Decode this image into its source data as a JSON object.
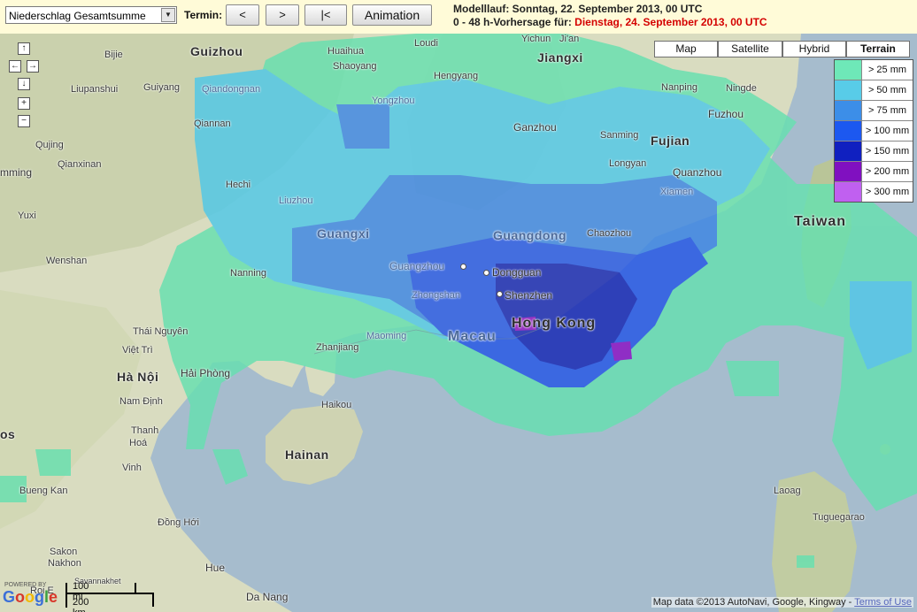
{
  "toolbar": {
    "product_select": "Niederschlag Gesamtsumme",
    "termin_label": "Termin:",
    "prev_label": "<",
    "next_label": ">",
    "first_label": "|<",
    "animation_label": "Animation",
    "model_run": "Modelllauf: Sonntag, 22. September 2013, 00 UTC",
    "forecast_prefix": "0 - 48 h-Vorhersage für: ",
    "forecast_date": "Dienstag, 24. September 2013, 00 UTC"
  },
  "map_types": {
    "map": "Map",
    "satellite": "Satellite",
    "hybrid": "Hybrid",
    "terrain": "Terrain",
    "selected": "terrain"
  },
  "legend": [
    {
      "label": "> 25 mm",
      "color": "#6ee8b8"
    },
    {
      "label": "> 50 mm",
      "color": "#58cce8"
    },
    {
      "label": "> 75 mm",
      "color": "#3c8ee8"
    },
    {
      "label": "> 100 mm",
      "color": "#1c58f0"
    },
    {
      "label": "> 150 mm",
      "color": "#1020c0"
    },
    {
      "label": "> 200 mm",
      "color": "#8010c0"
    },
    {
      "label": "> 300 mm",
      "color": "#c060f0"
    }
  ],
  "nav": {
    "up_icon": "arrow-up-icon",
    "left_icon": "arrow-left-icon",
    "right_icon": "arrow-right-icon",
    "down_icon": "arrow-down-icon",
    "zoom_in_icon": "plus-icon",
    "zoom_out_icon": "minus-icon"
  },
  "places": {
    "guizhou": "Guizhou",
    "bijie": "Bijie",
    "liupanshui": "Liupanshui",
    "guiyang": "Guiyang",
    "qiandongnan": "Qiandongnan",
    "qiannan": "Qiannan",
    "qujing": "Qujing",
    "mming": "mming",
    "qianxinan": "Qianxinan",
    "yuxi": "Yuxi",
    "hechi": "Hechi",
    "liuzhou": "Liuzhou",
    "guangxi": "Guangxi",
    "wenshan": "Wenshan",
    "nanning": "Nanning",
    "guangzhou": "Guangzhou",
    "dongguan": "Dongguan",
    "zhongshan": "Zhongshan",
    "shenzhen": "Shenzhen",
    "macau": "Macau",
    "hong_kong": "Hong Kong",
    "guangdong": "Guangdong",
    "chaozhou": "Chaozhou",
    "huaihua": "Huaihua",
    "shaoyang": "Shaoyang",
    "loudi": "Loudi",
    "hengyang": "Hengyang",
    "yongzhou": "Yongzhou",
    "yichun": "Yichun",
    "jiangxi": "Jiangxi",
    "ji_an": "Ji'an",
    "ganzhou": "Ganzhou",
    "nanping": "Nanping",
    "ningde": "Ningde",
    "fuzhou": "Fuzhou",
    "fujian": "Fujian",
    "sanming": "Sanming",
    "longyan": "Longyan",
    "quanzhou": "Quanzhou",
    "xiamen": "Xiamen",
    "taiwan": "Taiwan",
    "zhanjiang": "Zhanjiang",
    "maoming": "Maoming",
    "thai_nguyen": "Thái Nguyên",
    "viet_tri": "Việt Trì",
    "ha_noi": "Hà Nội",
    "hai_phong": "Hải Phòng",
    "nam_dinh": "Nam Định",
    "thanh_hoa": "Thanh",
    "thanh_hoa2": "Hoá",
    "os": "os",
    "vinh": "Vinh",
    "haikou": "Haikou",
    "hainan": "Hainan",
    "bueng_kan": "Bueng Kan",
    "sakon": "Sakon",
    "nakhon": "Nakhon",
    "dong_hoi": "Đồng Hới",
    "hue": "Hue",
    "da_nang": "Da Nang",
    "savannakhet": "Savannakhet",
    "roi_et": "Roi E",
    "laoag": "Laoag",
    "tuguegarao": "Tuguegarao"
  },
  "scale": {
    "miles": "100 mi",
    "km": "200 km"
  },
  "google": {
    "powered_by": "POWERED BY",
    "logo": "Google"
  },
  "attribution": {
    "text": "Map data ©2013 AutoNavi, Google, Kingway - ",
    "terms": "Terms of Use"
  }
}
